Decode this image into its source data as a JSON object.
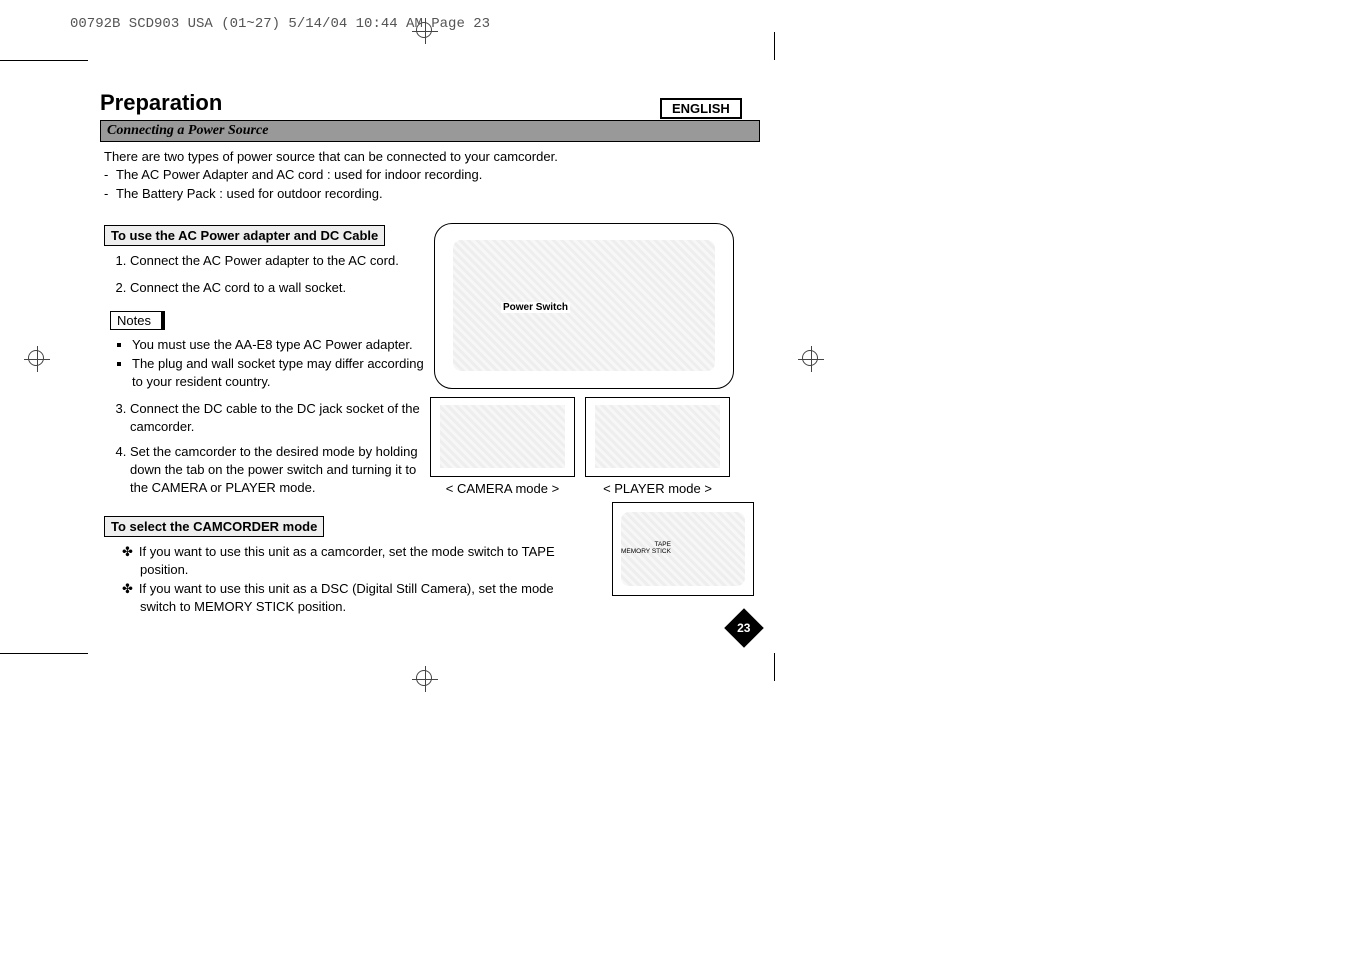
{
  "print_header": "00792B SCD903 USA (01~27)  5/14/04 10:44 AM  Page 23",
  "lang": "ENGLISH",
  "page_title": "Preparation",
  "section_title": "Connecting a Power Source",
  "intro": "There are two types of power source that can be connected to your camcorder.",
  "intro_items": [
    "The AC Power Adapter and AC cord : used for indoor recording.",
    "The Battery Pack : used for outdoor recording."
  ],
  "sub1_title": "To use the AC Power adapter and DC Cable",
  "steps_a": [
    "Connect the AC Power adapter to the AC cord.",
    "Connect the AC cord to a wall socket."
  ],
  "notes_label": "Notes",
  "notes": [
    "You must use the AA-E8 type AC Power adapter.",
    "The plug and wall socket type may differ according to your resident country."
  ],
  "steps_b_start": 3,
  "steps_b": [
    "Connect the DC cable to the DC jack socket of the camcorder.",
    "Set the camcorder to the desired mode by holding down the tab on the power switch and turning it to the CAMERA or PLAYER mode."
  ],
  "sub2_title": "To select the CAMCORDER mode",
  "mode_items": [
    "If you want to use this unit as a camcorder, set the mode switch to TAPE position.",
    "If you want to use this unit as a DSC (Digital Still Camera), set the mode switch to MEMORY STICK position."
  ],
  "figures": {
    "power_switch_label": "Power Switch",
    "camera_caption": "< CAMERA mode >",
    "player_caption": "< PLAYER mode >",
    "switch_labels": {
      "tape": "TAPE",
      "memstick": "MEMORY STICK"
    }
  },
  "page_number": "23"
}
